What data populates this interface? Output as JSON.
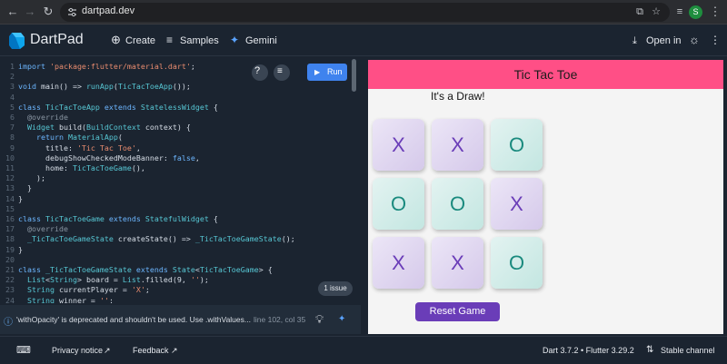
{
  "browser": {
    "url": "dartpad.dev",
    "profile_initial": "S",
    "icons": [
      "back-arrow-icon",
      "forward-arrow-icon",
      "reload-icon",
      "site-settings-icon",
      "cast-icon",
      "bookmark-star-icon",
      "media-control-icon",
      "menu-dots-icon"
    ]
  },
  "header": {
    "title": "DartPad",
    "create_label": "Create",
    "samples_label": "Samples",
    "gemini_label": "Gemini",
    "open_in_label": "Open in"
  },
  "editor": {
    "run_label": "Run",
    "issues_label": "1 issue",
    "lines": [
      {
        "n": "1",
        "t": [
          [
            "kw",
            "import "
          ],
          [
            "st",
            "'package:flutter/material.dart'"
          ],
          [
            "pl",
            ";"
          ]
        ]
      },
      {
        "n": "2",
        "t": []
      },
      {
        "n": "3",
        "t": [
          [
            "kw",
            "void "
          ],
          [
            "pl",
            "main() => "
          ],
          [
            "ty",
            "runApp"
          ],
          [
            "pl",
            "("
          ],
          [
            "ty",
            "TicTacToeApp"
          ],
          [
            "pl",
            "());"
          ]
        ]
      },
      {
        "n": "4",
        "t": []
      },
      {
        "n": "5",
        "t": [
          [
            "kw",
            "class "
          ],
          [
            "ty",
            "TicTacToeApp "
          ],
          [
            "kw",
            "extends "
          ],
          [
            "ty",
            "StatelessWidget "
          ],
          [
            "pl",
            "{"
          ]
        ]
      },
      {
        "n": "6",
        "t": [
          [
            "an",
            "  @override"
          ]
        ]
      },
      {
        "n": "7",
        "t": [
          [
            "ty",
            "  Widget "
          ],
          [
            "pl",
            "build("
          ],
          [
            "ty",
            "BuildContext "
          ],
          [
            "pl",
            "context) {"
          ]
        ]
      },
      {
        "n": "8",
        "t": [
          [
            "kw",
            "    return "
          ],
          [
            "ty",
            "MaterialApp"
          ],
          [
            "pl",
            "("
          ]
        ]
      },
      {
        "n": "9",
        "t": [
          [
            "pl",
            "      title: "
          ],
          [
            "st",
            "'Tic Tac Toe'"
          ],
          [
            "pl",
            ","
          ]
        ]
      },
      {
        "n": "10",
        "t": [
          [
            "pl",
            "      debugShowCheckedModeBanner: "
          ],
          [
            "kw",
            "false"
          ],
          [
            "pl",
            ","
          ]
        ]
      },
      {
        "n": "11",
        "t": [
          [
            "pl",
            "      home: "
          ],
          [
            "ty",
            "TicTacToeGame"
          ],
          [
            "pl",
            "(),"
          ]
        ]
      },
      {
        "n": "12",
        "t": [
          [
            "pl",
            "    );"
          ]
        ]
      },
      {
        "n": "13",
        "t": [
          [
            "pl",
            "  }"
          ]
        ]
      },
      {
        "n": "14",
        "t": [
          [
            "pl",
            "}"
          ]
        ]
      },
      {
        "n": "15",
        "t": []
      },
      {
        "n": "16",
        "t": [
          [
            "kw",
            "class "
          ],
          [
            "ty",
            "TicTacToeGame "
          ],
          [
            "kw",
            "extends "
          ],
          [
            "ty",
            "StatefulWidget "
          ],
          [
            "pl",
            "{"
          ]
        ]
      },
      {
        "n": "17",
        "t": [
          [
            "an",
            "  @override"
          ]
        ]
      },
      {
        "n": "18",
        "t": [
          [
            "ty",
            "  _TicTacToeGameState "
          ],
          [
            "pl",
            "createState() => "
          ],
          [
            "ty",
            "_TicTacToeGameState"
          ],
          [
            "pl",
            "();"
          ]
        ]
      },
      {
        "n": "19",
        "t": [
          [
            "pl",
            "}"
          ]
        ]
      },
      {
        "n": "20",
        "t": []
      },
      {
        "n": "21",
        "t": [
          [
            "kw",
            "class "
          ],
          [
            "ty",
            "_TicTacToeGameState "
          ],
          [
            "kw",
            "extends "
          ],
          [
            "ty",
            "State"
          ],
          [
            "pl",
            "<"
          ],
          [
            "ty",
            "TicTacToeGame"
          ],
          [
            "pl",
            "> {"
          ]
        ]
      },
      {
        "n": "22",
        "t": [
          [
            "ty",
            "  List"
          ],
          [
            "pl",
            "<"
          ],
          [
            "ty",
            "String"
          ],
          [
            "pl",
            "> board = "
          ],
          [
            "ty",
            "List"
          ],
          [
            "pl",
            ".filled(9, "
          ],
          [
            "st",
            "''"
          ],
          [
            "pl",
            ");"
          ]
        ]
      },
      {
        "n": "23",
        "t": [
          [
            "ty",
            "  String "
          ],
          [
            "pl",
            "currentPlayer = "
          ],
          [
            "st",
            "'X'"
          ],
          [
            "pl",
            ";"
          ]
        ]
      },
      {
        "n": "24",
        "t": [
          [
            "ty",
            "  String "
          ],
          [
            "pl",
            "winner = "
          ],
          [
            "st",
            "''"
          ],
          [
            "pl",
            ";"
          ]
        ]
      }
    ]
  },
  "issue": {
    "message": "'withOpacity' is deprecated and shouldn't be used. Use .withValues...",
    "location": "line 102, col 35"
  },
  "preview": {
    "app_bar_title": "Tic Tac Toe",
    "result": "It's a Draw!",
    "board": [
      "X",
      "X",
      "O",
      "O",
      "O",
      "X",
      "X",
      "X",
      "O"
    ],
    "reset_label": "Reset Game",
    "colors": {
      "app_bar": "#ff4f86",
      "x_mark": "#6a3db8",
      "o_mark": "#1a8a7e",
      "button": "#6a3db8"
    }
  },
  "footer": {
    "privacy_label": "Privacy notice",
    "feedback_label": "Feedback",
    "version": "Dart 3.7.2 • Flutter 3.29.2",
    "channel_label": "Stable channel"
  }
}
